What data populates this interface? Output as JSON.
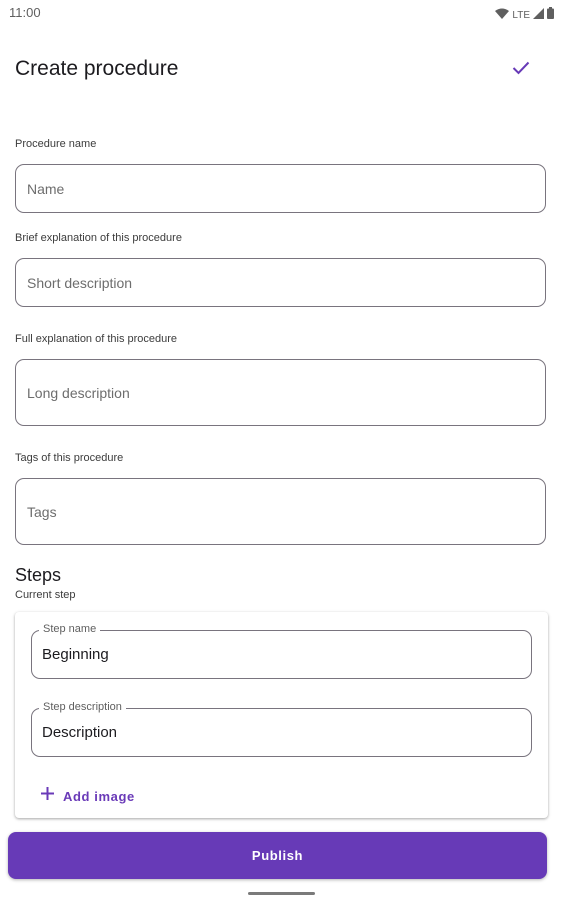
{
  "status_bar": {
    "time": "11:00",
    "network": "LTE",
    "icons": [
      "wifi-icon",
      "cellular-signal-icon",
      "battery-icon"
    ]
  },
  "app_bar": {
    "title": "Create procedure",
    "confirm_icon": "check-icon",
    "accent_color": "#673ab7"
  },
  "form": {
    "name": {
      "label": "Procedure name",
      "placeholder": "Name"
    },
    "short_description": {
      "label": "Brief explanation of this procedure",
      "placeholder": "Short description"
    },
    "long_description": {
      "label": "Full explanation of this procedure",
      "placeholder": "Long description"
    },
    "tags": {
      "label": "Tags of this procedure",
      "placeholder": "Tags"
    }
  },
  "steps": {
    "heading": "Steps",
    "current_step_label": "Current step",
    "step_name": {
      "label": "Step name",
      "value": "Beginning"
    },
    "step_description": {
      "label": "Step description",
      "value": "Description"
    },
    "add_image_label": "Add image",
    "add_image_icon": "plus-icon"
  },
  "publish_label": "Publish"
}
